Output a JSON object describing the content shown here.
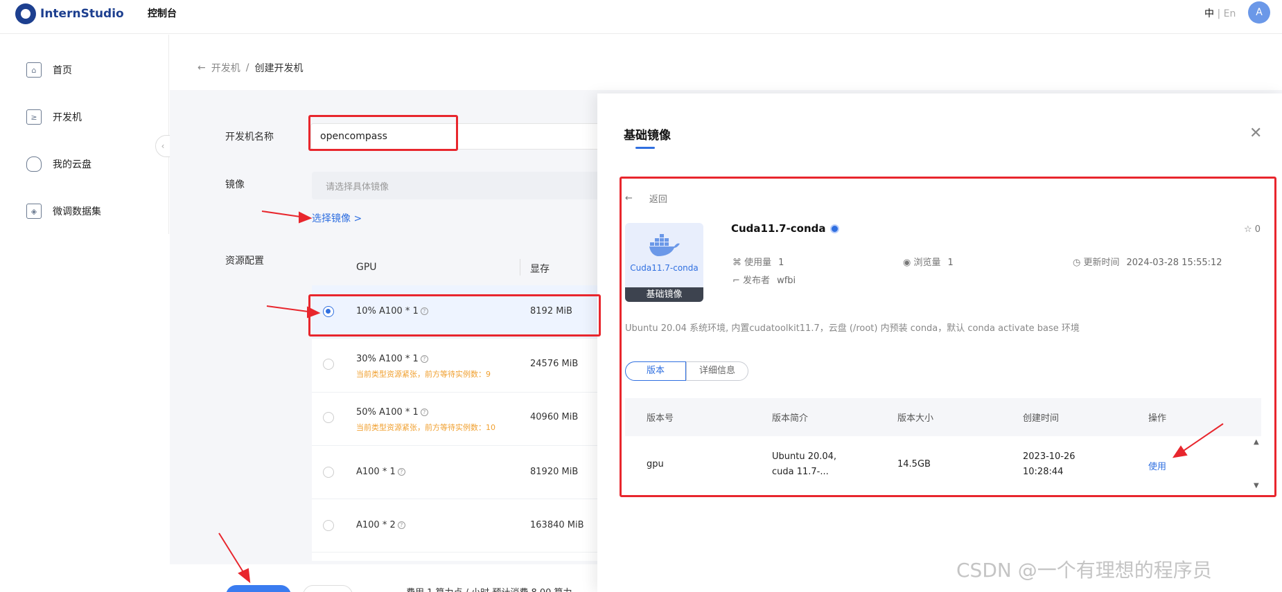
{
  "header": {
    "logo_text": "InternStudio",
    "console_label": "控制台",
    "lang_zh": "中",
    "lang_sep": "|",
    "lang_en": "En",
    "avatar_letter": "A"
  },
  "sidebar": {
    "items": [
      {
        "label": "首页",
        "icon": "home-icon"
      },
      {
        "label": "开发机",
        "icon": "terminal-icon"
      },
      {
        "label": "我的云盘",
        "icon": "cloud-icon"
      },
      {
        "label": "微调数据集",
        "icon": "layers-icon"
      }
    ],
    "collapse_glyph": "‹"
  },
  "breadcrumb": {
    "back_glyph": "←",
    "parent": "开发机",
    "separator": "/",
    "current": "创建开发机"
  },
  "form": {
    "name_label": "开发机名称",
    "name_value": "opencompass",
    "image_label": "镜像",
    "image_placeholder": "请选择具体镜像",
    "choose_image_link": "选择镜像 >",
    "resource_label": "资源配置"
  },
  "resources": {
    "headers": [
      "GPU",
      "显存"
    ],
    "rows": [
      {
        "gpu": "10% A100 * 1",
        "memory": "8192 MiB",
        "warning": "",
        "selected": true
      },
      {
        "gpu": "30% A100 * 1",
        "memory": "24576 MiB",
        "warning": "当前类型资源紧张，前方等待实例数：9",
        "selected": false
      },
      {
        "gpu": "50% A100 * 1",
        "memory": "40960 MiB",
        "warning": "当前类型资源紧张，前方等待实例数：10",
        "selected": false
      },
      {
        "gpu": "A100 * 1",
        "memory": "81920 MiB",
        "warning": "",
        "selected": false
      },
      {
        "gpu": "A100 * 2",
        "memory": "163840 MiB",
        "warning": "",
        "selected": false
      }
    ]
  },
  "footer": {
    "fee_text": "费用 1 算力点 / 小时 预计消费 8.00 算力"
  },
  "panel": {
    "title": "基础镜像",
    "close_glyph": "✕",
    "back_label": "返回",
    "image": {
      "name": "Cuda11.7-conda",
      "card_name": "Cuda11.7-conda",
      "card_tag": "基础镜像",
      "stars": "0",
      "usage_label": "使用量",
      "usage_value": "1",
      "views_label": "浏览量",
      "views_value": "1",
      "updated_label": "更新时间",
      "updated_value": "2024-03-28 15:55:12",
      "publisher_label": "发布者",
      "publisher_value": "wfbi",
      "description": "Ubuntu 20.04 系统环境, 内置cudatoolkit11.7，云盘 (/root) 内预装 conda，默认 conda activate base 环境"
    },
    "tabs": [
      "版本",
      "详细信息"
    ],
    "version_table": {
      "headers": [
        "版本号",
        "版本简介",
        "版本大小",
        "创建时间",
        "操作"
      ],
      "rows": [
        {
          "version": "gpu",
          "summary_line1": "Ubuntu 20.04,",
          "summary_line2": "cuda 11.7-...",
          "size": "14.5GB",
          "created_date": "2023-10-26",
          "created_time": "10:28:44",
          "action": "使用"
        }
      ]
    }
  },
  "watermark": "CSDN @一个有理想的程序员",
  "colors": {
    "accent": "#2f6fe0",
    "annotation": "#e8262d",
    "warning": "#f0a030"
  }
}
